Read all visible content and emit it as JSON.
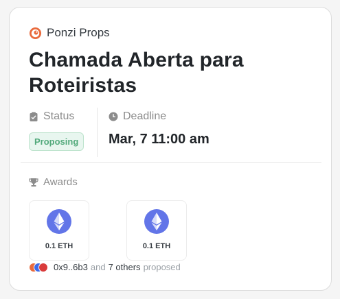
{
  "org": {
    "name": "Ponzi Props",
    "logo_icon": "ponzi-logo-icon",
    "logo_color": "#e96a3c"
  },
  "round": {
    "title": "Chamada Aberta para Roteiristas"
  },
  "status": {
    "label": "Status",
    "icon": "clipboard-icon",
    "value": "Proposing",
    "badge_color": "#52a97b"
  },
  "deadline": {
    "label": "Deadline",
    "icon": "clock-icon",
    "value": "Mar, 7 11:00 am"
  },
  "awards": {
    "label": "Awards",
    "icon": "trophy-icon",
    "items": [
      {
        "amount": "0.1 ETH",
        "icon": "ethereum-icon"
      },
      {
        "amount": "0.1 ETH",
        "icon": "ethereum-icon"
      }
    ]
  },
  "proposers": {
    "address": "0x9..6b3",
    "and": "and",
    "others": "7 others",
    "proposed": "proposed"
  }
}
